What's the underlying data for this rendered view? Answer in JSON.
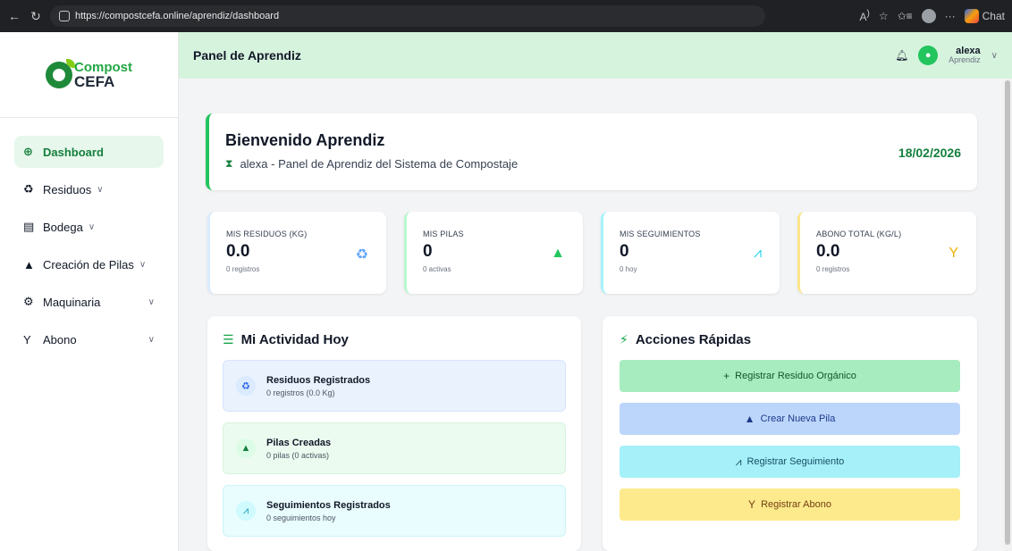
{
  "browser": {
    "url": "https://compostcefa.online/aprendiz/dashboard",
    "copilot_label": "Chat"
  },
  "logo": {
    "line1": "Compost",
    "line2": "CEFA"
  },
  "sidebar": {
    "items": [
      {
        "label": "Dashboard",
        "icon": "globe-icon"
      },
      {
        "label": "Residuos",
        "icon": "recycle-icon"
      },
      {
        "label": "Bodega",
        "icon": "warehouse-icon"
      },
      {
        "label": "Creación de Pilas",
        "icon": "mountain-icon"
      },
      {
        "label": "Maquinaria",
        "icon": "cogs-icon"
      },
      {
        "label": "Abono",
        "icon": "seedling-icon"
      }
    ]
  },
  "topbar": {
    "title": "Panel de Aprendiz",
    "user_name": "alexa",
    "user_role": "Aprendiz"
  },
  "welcome": {
    "title": "Bienvenido Aprendiz",
    "subtitle": "alexa - Panel de Aprendiz del Sistema de Compostaje",
    "date": "18/02/2026"
  },
  "stats": [
    {
      "label": "MIS RESIDUOS (KG)",
      "value": "0.0",
      "sub": "0 registros",
      "color": "#60a5fa"
    },
    {
      "label": "MIS PILAS",
      "value": "0",
      "sub": "0 activas",
      "color": "#22c55e"
    },
    {
      "label": "MIS SEGUIMIENTOS",
      "value": "0",
      "sub": "0 hoy",
      "color": "#22d3ee"
    },
    {
      "label": "ABONO TOTAL (KG/L)",
      "value": "0.0",
      "sub": "0 registros",
      "color": "#eab308"
    }
  ],
  "activity": {
    "title": "Mi Actividad Hoy",
    "items": [
      {
        "title": "Residuos Registrados",
        "sub": "0 registros (0.0 Kg)"
      },
      {
        "title": "Pilas Creadas",
        "sub": "0 pilas (0 activas)"
      },
      {
        "title": "Seguimientos Registrados",
        "sub": "0 seguimientos hoy"
      }
    ]
  },
  "quick": {
    "title": "Acciones Rápidas",
    "buttons": [
      {
        "label": "Registrar Residuo Orgánico"
      },
      {
        "label": "Crear Nueva Pila"
      },
      {
        "label": "Registrar Seguimiento"
      },
      {
        "label": "Registrar Abono"
      }
    ]
  }
}
